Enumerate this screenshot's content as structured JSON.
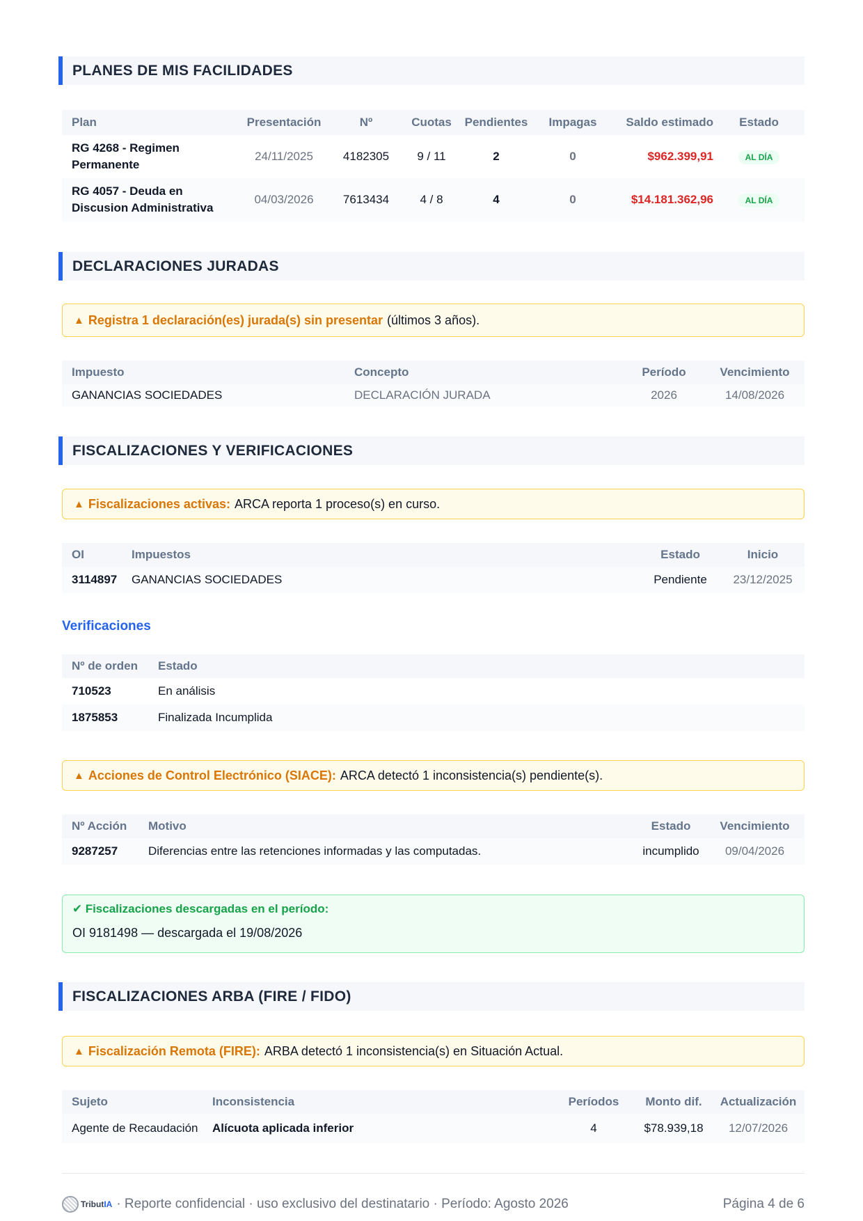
{
  "planes": {
    "title": "PLANES DE MIS FACILIDADES",
    "headers": {
      "plan": "Plan",
      "presentacion": "Presentación",
      "numero": "Nº",
      "cuotas": "Cuotas",
      "pendientes": "Pendientes",
      "impagas": "Impagas",
      "saldo": "Saldo estimado",
      "estado": "Estado"
    },
    "rows": [
      {
        "plan_l1": "RG 4268 - Regimen",
        "plan_l2": "Permanente",
        "presentacion": "24/11/2025",
        "numero": "4182305",
        "cuotas": "9 / 11",
        "pendientes": "2",
        "impagas": "0",
        "saldo": "$962.399,91",
        "estado": "AL DÍA"
      },
      {
        "plan_l1": "RG 4057 - Deuda en",
        "plan_l2": "Discusion Administrativa",
        "presentacion": "04/03/2026",
        "numero": "7613434",
        "cuotas": "4 / 8",
        "pendientes": "4",
        "impagas": "0",
        "saldo": "$14.181.362,96",
        "estado": "AL DÍA"
      }
    ]
  },
  "ddjj": {
    "title": "DECLARACIONES JURADAS",
    "alert_lead": "Registra 1 declaración(es) jurada(s) sin presentar",
    "alert_text": "(últimos 3 años).",
    "headers": {
      "impuesto": "Impuesto",
      "concepto": "Concepto",
      "periodo": "Período",
      "vencimiento": "Vencimiento"
    },
    "rows": [
      {
        "impuesto": "GANANCIAS SOCIEDADES",
        "concepto": "DECLARACIÓN JURADA",
        "periodo": "2026",
        "vencimiento": "14/08/2026"
      }
    ]
  },
  "fisc": {
    "title": "FISCALIZACIONES Y VERIFICACIONES",
    "alert_lead": "Fiscalizaciones activas:",
    "alert_text": "ARCA reporta 1 proceso(s) en curso.",
    "headers": {
      "oi": "OI",
      "impuestos": "Impuestos",
      "estado": "Estado",
      "inicio": "Inicio"
    },
    "rows": [
      {
        "oi": "3114897",
        "impuestos": "GANANCIAS SOCIEDADES",
        "estado": "Pendiente",
        "inicio": "23/12/2025"
      }
    ],
    "verif_title": "Verificaciones",
    "verif_headers": {
      "orden": "Nº de orden",
      "estado": "Estado"
    },
    "verif_rows": [
      {
        "orden": "710523",
        "estado": "En análisis"
      },
      {
        "orden": "1875853",
        "estado": "Finalizada Incumplida"
      }
    ],
    "siace_lead": "Acciones de Control Electrónico (SIACE):",
    "siace_text": "ARCA detectó 1 inconsistencia(s) pendiente(s).",
    "siace_headers": {
      "accion": "Nº Acción",
      "motivo": "Motivo",
      "estado": "Estado",
      "vencimiento": "Vencimiento"
    },
    "siace_rows": [
      {
        "accion": "9287257",
        "motivo": "Diferencias entre las retenciones informadas y las computadas.",
        "estado": "incumplido",
        "vencimiento": "09/04/2026"
      }
    ],
    "descargadas_lead": "Fiscalizaciones descargadas en el período:",
    "descargadas_text": "OI 9181498 — descargada el 19/08/2026"
  },
  "arba": {
    "title": "FISCALIZACIONES ARBA (FIRE / FIDO)",
    "alert_lead": "Fiscalización Remota (FIRE):",
    "alert_text": "ARBA detectó 1 inconsistencia(s) en Situación Actual.",
    "headers": {
      "sujeto": "Sujeto",
      "inconsistencia": "Inconsistencia",
      "periodos": "Períodos",
      "monto": "Monto dif.",
      "actualizacion": "Actualización"
    },
    "rows": [
      {
        "sujeto": "Agente de Recaudación",
        "inconsistencia": "Alícuota aplicada inferior",
        "periodos": "4",
        "monto": "$78.939,18",
        "actualizacion": "12/07/2026"
      }
    ]
  },
  "footer": {
    "logo_text_a": "Tribut",
    "logo_text_b": "IA",
    "text": "· Reporte confidencial · uso exclusivo del destinatario · Período: Agosto 2026",
    "page": "Página 4 de 6"
  }
}
